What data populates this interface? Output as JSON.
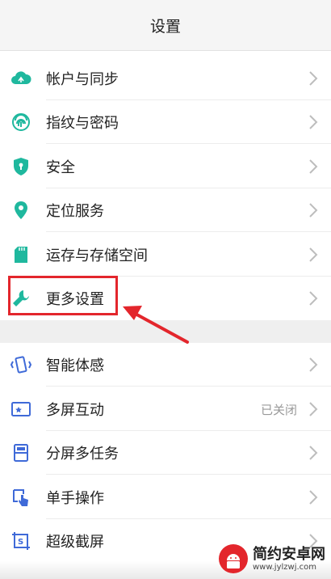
{
  "header": {
    "title": "设置"
  },
  "colors": {
    "teal": "#1fb89e",
    "blue": "#3f6ad8",
    "red": "#e3262c"
  },
  "section1": [
    {
      "label": "帐户与同步",
      "icon": "cloud-sync-icon"
    },
    {
      "label": "指纹与密码",
      "icon": "fingerprint-icon"
    },
    {
      "label": "安全",
      "icon": "shield-icon"
    },
    {
      "label": "定位服务",
      "icon": "location-pin-icon"
    },
    {
      "label": "运存与存储空间",
      "icon": "sd-card-icon"
    },
    {
      "label": "更多设置",
      "icon": "wrench-icon"
    }
  ],
  "section2": [
    {
      "label": "智能体感",
      "icon": "motion-phone-icon"
    },
    {
      "label": "多屏互动",
      "icon": "multi-screen-icon",
      "status": "已关闭"
    },
    {
      "label": "分屏多任务",
      "icon": "split-screen-icon"
    },
    {
      "label": "单手操作",
      "icon": "one-hand-icon"
    },
    {
      "label": "超级截屏",
      "icon": "screenshot-icon"
    }
  ],
  "watermark": {
    "main": "简约安卓网",
    "sub": "www.jylzwj.com"
  }
}
